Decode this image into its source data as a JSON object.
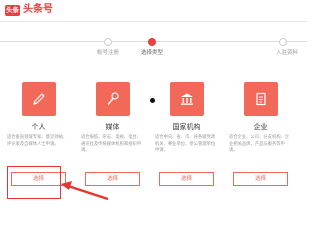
{
  "header": {
    "logo_badge": "头条",
    "logo_text": "头条号"
  },
  "steps": [
    {
      "label": "帐号注册",
      "active": false
    },
    {
      "label": "选择类型",
      "active": true
    },
    {
      "label": "入驻资料",
      "active": false
    }
  ],
  "cards": [
    {
      "title": "个人",
      "desc": "适合垂直领域专家、意见领袖、评论家及自媒体人士申请。",
      "button": "选择",
      "icon": "pen-icon"
    },
    {
      "title": "媒体",
      "desc": "适合报纸、杂志、电视、电台、通讯社及传统媒体机构和组织申请。",
      "button": "选择",
      "icon": "microphone-icon"
    },
    {
      "title": "国家机构",
      "desc": "适合中央、省、市、县各级党政机关、事业单位、参公管理单位申请。",
      "button": "选择",
      "icon": "government-building-icon"
    },
    {
      "title": "企业",
      "desc": "适合企业、公司、分支机构、企业相关品牌、产品与服务等申请。",
      "button": "选择",
      "icon": "document-icon"
    }
  ],
  "colors": {
    "brand": "#e83f3f",
    "accent": "#f2695a",
    "annotation": "#e8332e"
  }
}
